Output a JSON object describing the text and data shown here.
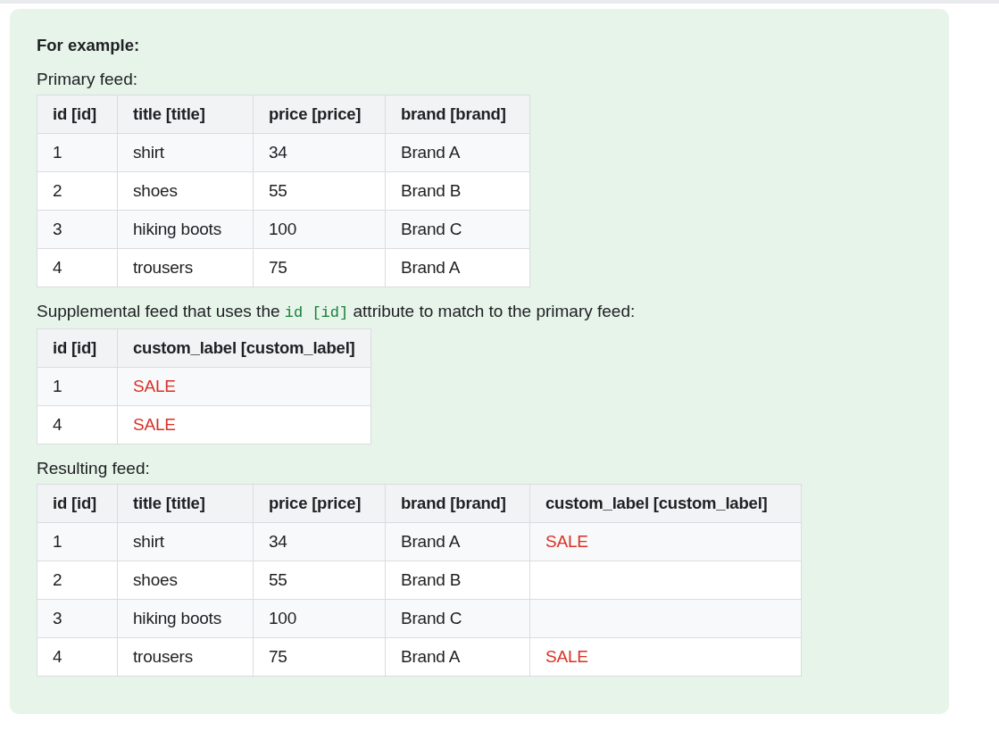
{
  "heading": "For example:",
  "sections": [
    {
      "caption": [
        {
          "kind": "text",
          "text": "Primary feed:"
        }
      ],
      "table": {
        "columns": [
          "id [id]",
          "title [title]",
          "price [price]",
          "brand [brand]"
        ],
        "rows": [
          [
            {
              "text": "1"
            },
            {
              "text": "shirt"
            },
            {
              "text": "34"
            },
            {
              "text": "Brand A"
            }
          ],
          [
            {
              "text": "2"
            },
            {
              "text": "shoes"
            },
            {
              "text": "55"
            },
            {
              "text": "Brand B"
            }
          ],
          [
            {
              "text": "3"
            },
            {
              "text": "hiking boots"
            },
            {
              "text": "100"
            },
            {
              "text": "Brand C"
            }
          ],
          [
            {
              "text": "4"
            },
            {
              "text": "trousers"
            },
            {
              "text": "75"
            },
            {
              "text": "Brand A"
            }
          ]
        ]
      }
    },
    {
      "caption": [
        {
          "kind": "text",
          "text": "Supplemental feed that uses the "
        },
        {
          "kind": "code",
          "text": "id [id]"
        },
        {
          "kind": "text",
          "text": " attribute to match to the primary feed:"
        }
      ],
      "table": {
        "columns": [
          "id [id]",
          "custom_label [custom_label]"
        ],
        "rows": [
          [
            {
              "text": "1"
            },
            {
              "text": "SALE",
              "color": "#d93025"
            }
          ],
          [
            {
              "text": "4"
            },
            {
              "text": "SALE",
              "color": "#d93025"
            }
          ]
        ]
      }
    },
    {
      "caption": [
        {
          "kind": "text",
          "text": "Resulting feed:"
        }
      ],
      "table": {
        "columns": [
          "id [id]",
          "title [title]",
          "price [price]",
          "brand [brand]",
          "custom_label [custom_label]"
        ],
        "rows": [
          [
            {
              "text": "1"
            },
            {
              "text": "shirt"
            },
            {
              "text": "34"
            },
            {
              "text": "Brand A"
            },
            {
              "text": "SALE",
              "color": "#d93025"
            }
          ],
          [
            {
              "text": "2"
            },
            {
              "text": "shoes"
            },
            {
              "text": "55"
            },
            {
              "text": "Brand B"
            },
            null
          ],
          [
            {
              "text": "3"
            },
            {
              "text": "hiking boots"
            },
            {
              "text": "100"
            },
            {
              "text": "Brand C"
            },
            null
          ],
          [
            {
              "text": "4"
            },
            {
              "text": "trousers"
            },
            {
              "text": "75"
            },
            {
              "text": "Brand A"
            },
            {
              "text": "SALE",
              "color": "#d93025"
            }
          ]
        ]
      }
    }
  ]
}
